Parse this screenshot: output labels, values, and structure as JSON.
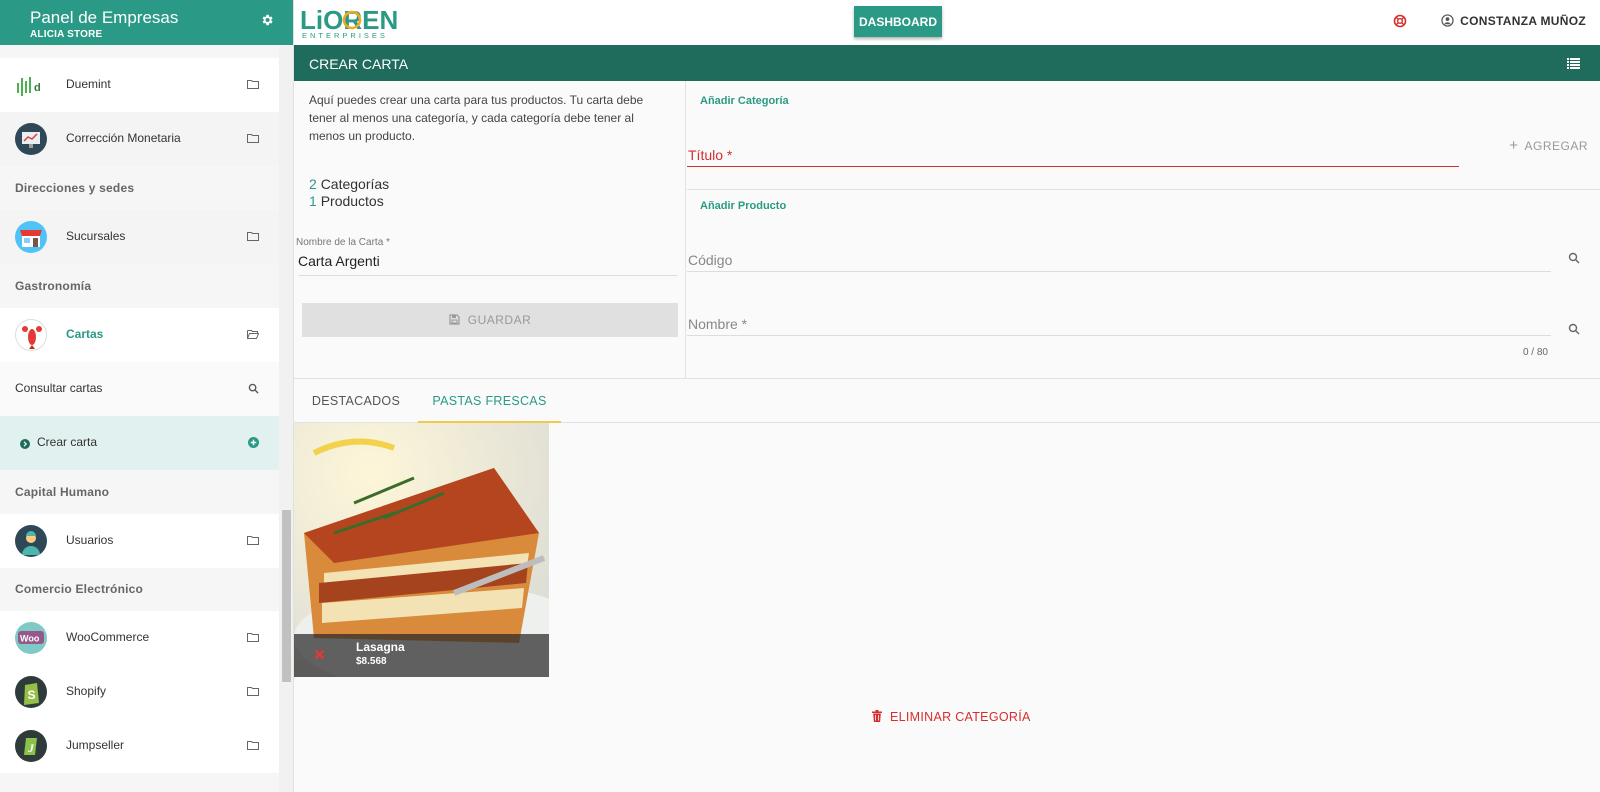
{
  "sidebar": {
    "title": "Panel de Empresas",
    "subtitle": "ALICIA STORE",
    "items": [
      {
        "label": "Duemint"
      },
      {
        "label": "Corrección Monetaria"
      },
      {
        "section": "Direcciones y sedes"
      },
      {
        "label": "Sucursales"
      },
      {
        "section": "Gastronomía"
      },
      {
        "label": "Cartas"
      },
      {
        "sub": "Consultar cartas"
      },
      {
        "sub": "Crear carta"
      },
      {
        "section": "Capital Humano"
      },
      {
        "label": "Usuarios"
      },
      {
        "section": "Comercio Electrónico"
      },
      {
        "label": "WooCommerce"
      },
      {
        "label": "Shopify"
      },
      {
        "label": "Jumpseller"
      }
    ]
  },
  "topbar": {
    "logo_main": "LIOREN",
    "logo_sub": "ENTERPRISES",
    "dashboard_label": "DASHBOARD",
    "user_name": "CONSTANZA MUÑOZ"
  },
  "panel": {
    "title": "CREAR CARTA",
    "description": "Aquí puedes crear una carta para tus productos. Tu carta debe tener al menos una categoría, y cada categoría debe tener al menos un producto.",
    "categories_count": "2",
    "categories_label": "Categorías",
    "products_count": "1",
    "products_label": "Productos",
    "name_label": "Nombre de la Carta *",
    "name_value": "Carta Argenti",
    "save_label": "GUARDAR"
  },
  "add_category": {
    "section_label": "Añadir Categoría",
    "title_placeholder": "Título *",
    "add_label": "AGREGAR"
  },
  "add_product": {
    "section_label": "Añadir Producto",
    "code_placeholder": "Código",
    "name_placeholder": "Nombre *",
    "counter": "0 / 80"
  },
  "tabs": [
    {
      "label": "DESTACADOS",
      "active": false
    },
    {
      "label": "PASTAS FRESCAS",
      "active": true
    }
  ],
  "product": {
    "name": "Lasagna",
    "price": "$8.568"
  },
  "delete_category_label": "ELIMINAR CATEGORÍA",
  "colors": {
    "primary": "#2a9a86",
    "header_dark": "#1f6c5d",
    "danger": "#d32f2f",
    "tab_accent": "#f2c94c"
  }
}
